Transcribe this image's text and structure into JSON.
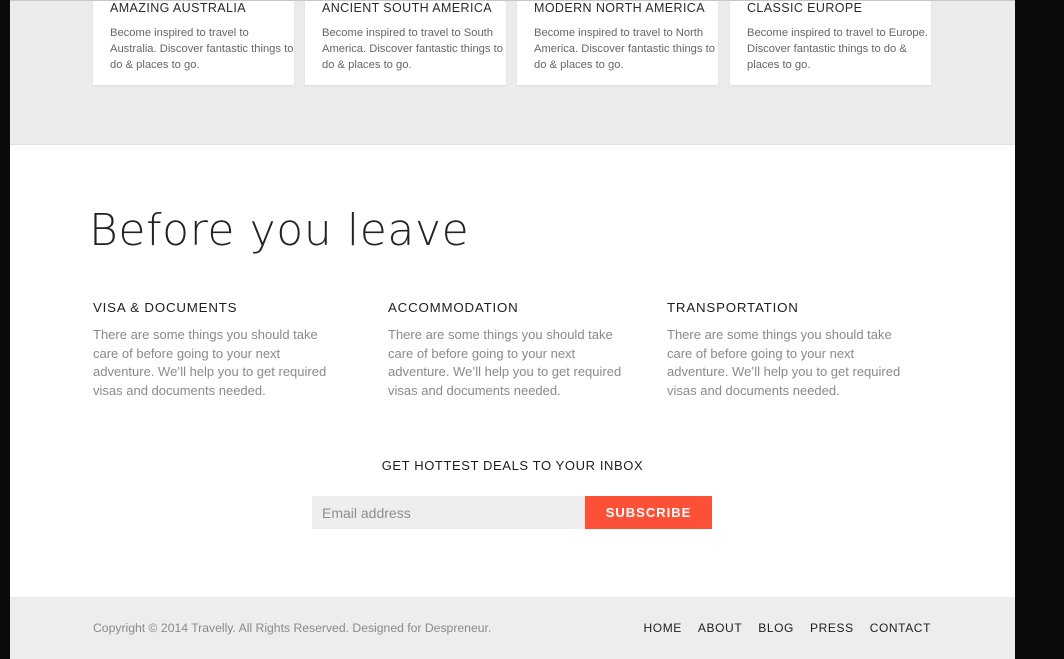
{
  "destinations": [
    {
      "title": "AMAZING AUSTRALIA",
      "description": "Become inspired to travel to Australia. Discover fantastic things to do & places to go."
    },
    {
      "title": "ANCIENT SOUTH AMERICA",
      "description": "Become inspired to travel to South America. Discover fantastic things to do & places to go."
    },
    {
      "title": "MODERN NORTH AMERICA",
      "description": "Become inspired to travel to North America. Discover fantastic things to do & places to go."
    },
    {
      "title": "CLASSIC EUROPE",
      "description": "Become inspired to travel to Europe. Discover fantastic things to do & places to go."
    }
  ],
  "before_you_leave": {
    "title": "Before you leave",
    "columns": [
      {
        "heading": "VISA & DOCUMENTS",
        "text": "There are some things you should take care of before going to your next adventure. We’ll help you to get required visas and documents needed."
      },
      {
        "heading": "ACCOMMODATION",
        "text": "There are some things you should take care of before going to your next adventure. We’ll help you to get required visas and documents needed."
      },
      {
        "heading": "TRANSPORTATION",
        "text": "There are some things you should take care of before going to your next adventure. We’ll help you to get required visas and documents needed."
      }
    ]
  },
  "newsletter": {
    "label": "GET HOTTEST DEALS TO YOUR INBOX",
    "email_value": "",
    "email_placeholder": "Email address",
    "subscribe_label": "SUBSCRIBE",
    "accent_color": "#fc5136"
  },
  "footer": {
    "copyright": "Copyright © 2014 Travelly. All Rights Reserved. Designed for Despreneur.",
    "nav": [
      "HOME",
      "ABOUT",
      "BLOG",
      "PRESS",
      "CONTACT"
    ]
  }
}
